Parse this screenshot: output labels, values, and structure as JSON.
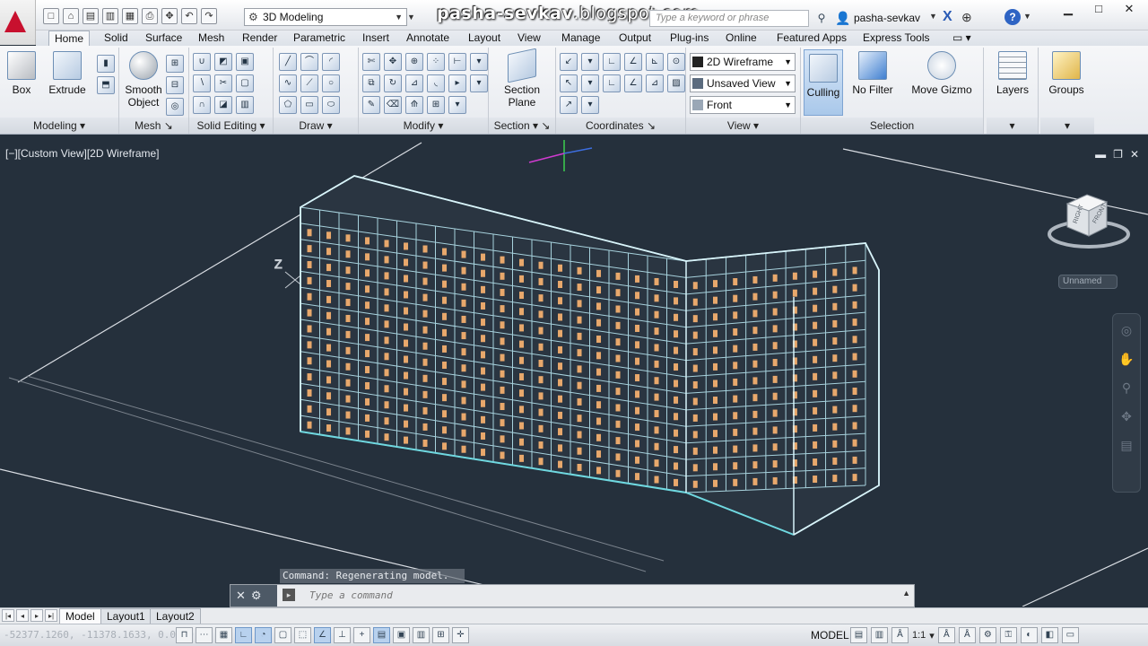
{
  "titlebar": {
    "workspace": "3D Modeling",
    "watermark_bold": "pasha-sevkav",
    "watermark_rest": ".blogspot.com",
    "search_placeholder": "Type a keyword or phrase",
    "user": "pasha-sevkav",
    "help": "?"
  },
  "tabs": [
    "Home",
    "Solid",
    "Surface",
    "Mesh",
    "Render",
    "Parametric",
    "Insert",
    "Annotate",
    "Layout",
    "View",
    "Manage",
    "Output",
    "Plug-ins",
    "Online",
    "Featured Apps",
    "Express Tools"
  ],
  "ribbon": {
    "modeling": {
      "title": "Modeling",
      "box": "Box",
      "extrude": "Extrude"
    },
    "mesh": {
      "title": "Mesh",
      "smooth_object": "Smooth Object"
    },
    "solid_editing": {
      "title": "Solid Editing"
    },
    "draw": {
      "title": "Draw"
    },
    "modify": {
      "title": "Modify"
    },
    "section": {
      "title": "Section",
      "section_plane": "Section Plane"
    },
    "coordinates": {
      "title": "Coordinates"
    },
    "view": {
      "title": "View",
      "visual_style": "2D Wireframe",
      "named_view": "Unsaved View",
      "ucs_view": "Front"
    },
    "selection": {
      "title": "Selection",
      "culling": "Culling",
      "no_filter": "No Filter",
      "move_gizmo": "Move Gizmo"
    },
    "layers": {
      "label": "Layers"
    },
    "groups": {
      "label": "Groups"
    }
  },
  "viewport": {
    "label": "[−][Custom View][2D Wireframe]",
    "unnamed": "Unnamed",
    "viewcube_right": "RIGHT",
    "viewcube_front": "FRONT"
  },
  "command": {
    "history": "Command:  Regenerating model.",
    "placeholder": "Type a command"
  },
  "layout_tabs": [
    "Model",
    "Layout1",
    "Layout2"
  ],
  "status": {
    "coords": "-52377.1260, -11378.1633, 0.0000",
    "model": "MODEL",
    "scale": "1:1"
  }
}
